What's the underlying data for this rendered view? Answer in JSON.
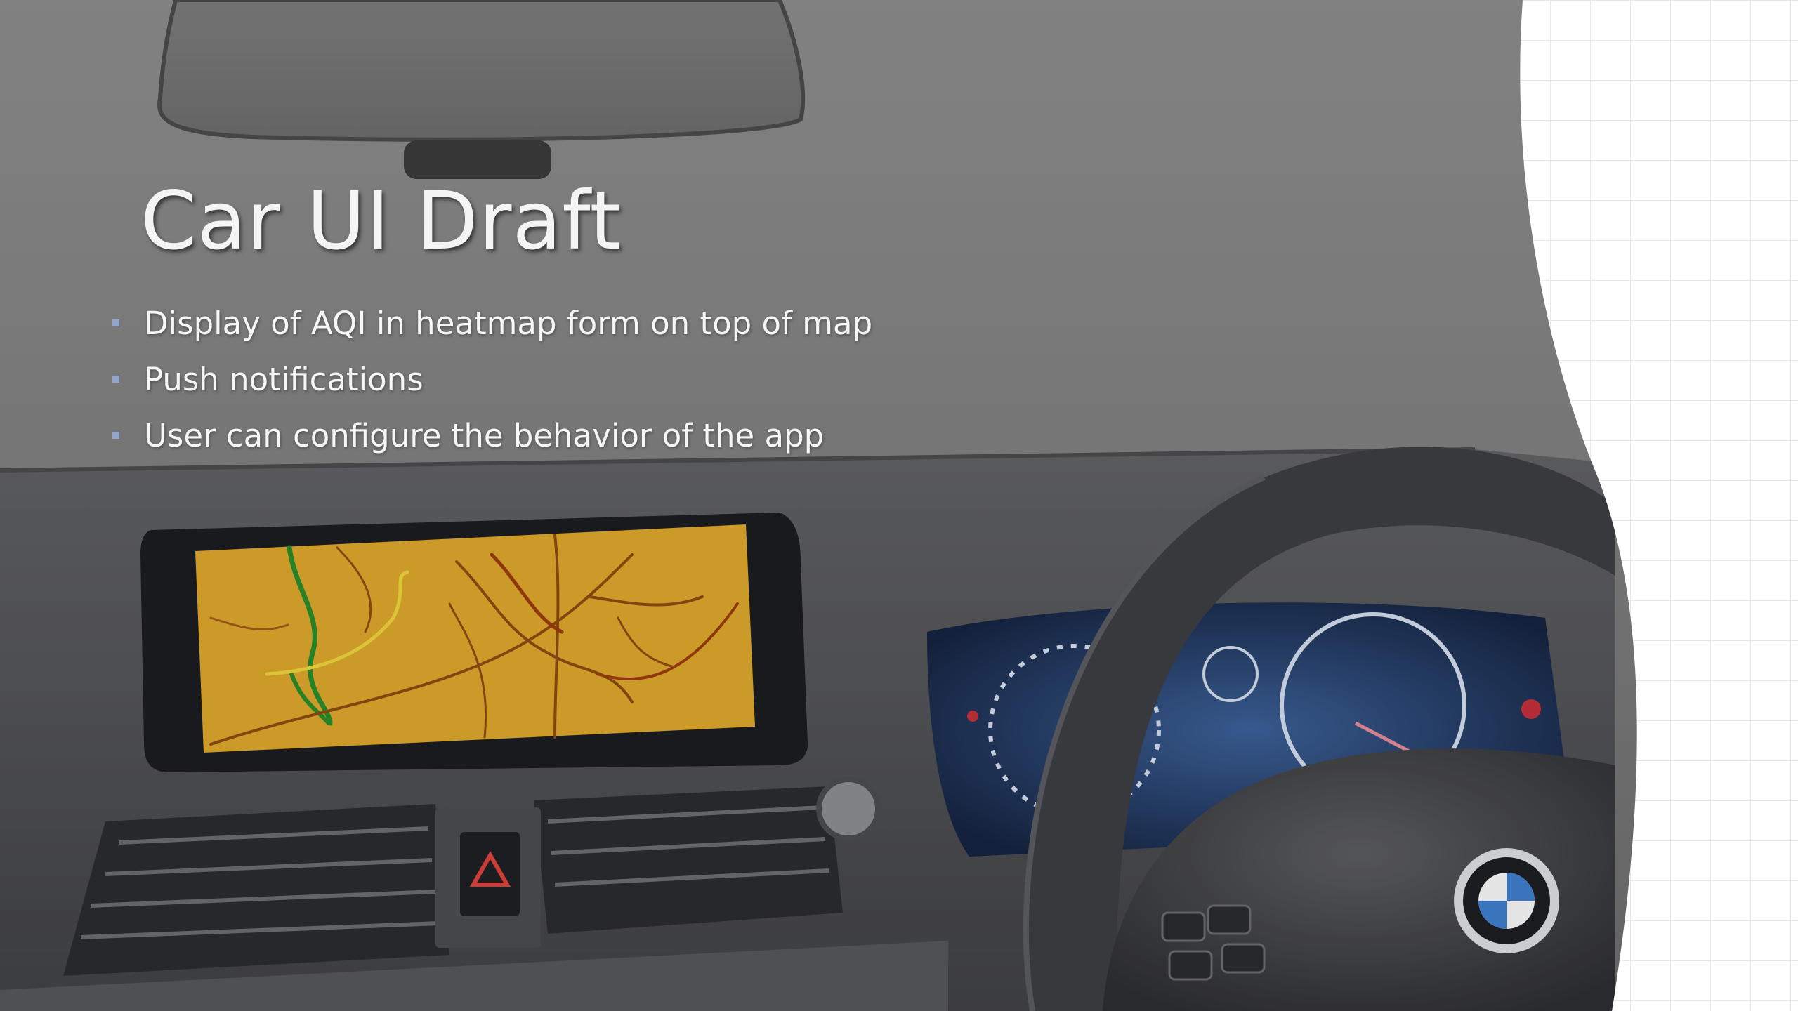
{
  "slide": {
    "title": "Car UI Draft",
    "bullets": [
      "Display of AQI in heatmap form on top of map",
      "Push notifications",
      "User can configure the behavior of the app"
    ]
  },
  "colors": {
    "photo_tint": "#8c8c8c",
    "map_screen": "#d9a42c",
    "bullet_accent": "#8fa7c8",
    "background": "#ffffff"
  },
  "icons": [
    "hazard-icon",
    "bmw-logo-icon"
  ]
}
